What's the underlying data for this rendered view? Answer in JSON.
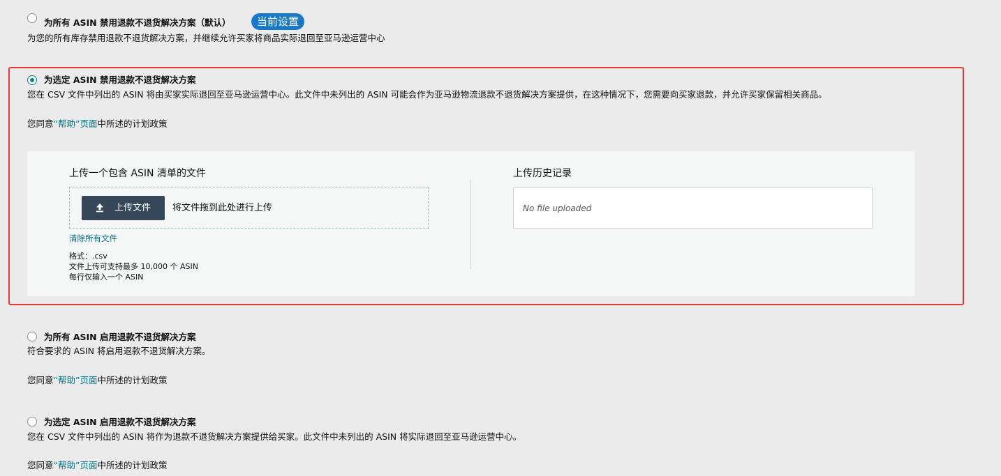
{
  "options": [
    {
      "title": "为所有 ASIN 禁用退款不退货解决方案（默认）",
      "badge": "当前设置",
      "description": "为您的所有库存禁用退款不退货解决方案，并继续允许买家将商品实际退回至亚马逊运营中心",
      "selected": false
    },
    {
      "title": "为选定 ASIN 禁用退款不退货解决方案",
      "description": "您在 CSV 文件中列出的 ASIN 将由买家实际退回至亚马逊运营中心。此文件中未列出的 ASIN 可能会作为亚马逊物流退款不退货解决方案提供，在这种情况下，您需要向买家退款，并允许买家保留相关商品。",
      "agree_prefix": "您同意",
      "agree_link": "“帮助”页面",
      "agree_suffix": "中所述的计划政策",
      "selected": true
    },
    {
      "title": "为所有 ASIN 启用退款不退货解决方案",
      "description": "符合要求的 ASIN 将启用退款不退货解决方案。",
      "agree_prefix": "您同意",
      "agree_link": "“帮助”页面",
      "agree_suffix": "中所述的计划政策",
      "selected": false
    },
    {
      "title": "为选定 ASIN 启用退款不退货解决方案",
      "description": "您在 CSV 文件中列出的 ASIN 将作为退款不退货解决方案提供给买家。此文件中未列出的 ASIN 将实际退回至亚马逊运营中心。",
      "agree_prefix": "您同意",
      "agree_link": "“帮助”页面",
      "agree_suffix": "中所述的计划政策",
      "selected": false
    }
  ],
  "upload": {
    "title": "上传一个包含 ASIN 清单的文件",
    "button_label": "上传文件",
    "drop_hint": "将文件拖到此处进行上传",
    "clear_link": "清除所有文件",
    "notes": [
      "格式：.csv",
      "文件上传可支持最多 10,000 个 ASIN",
      "每行仅输入一个 ASIN"
    ]
  },
  "history": {
    "title": "上传历史记录",
    "empty_text": "No file uploaded"
  },
  "colors": {
    "accent": "#007185",
    "badge": "#1a78c8",
    "highlight_border": "#e53935",
    "button": "#37475a"
  }
}
